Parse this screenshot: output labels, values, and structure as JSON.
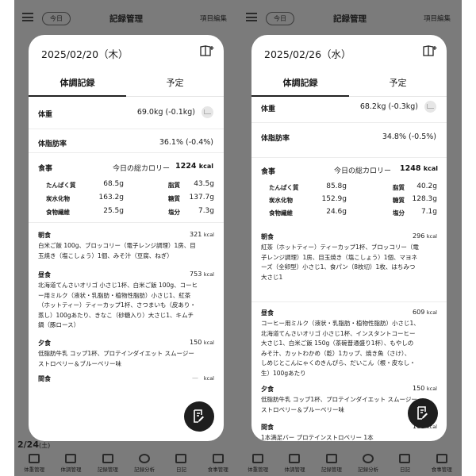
{
  "app": {
    "title": "記録管理",
    "today_label": "今日",
    "item_edit_label": "項目編集"
  },
  "nav": [
    {
      "label": "体重管理",
      "icon": "scale-icon"
    },
    {
      "label": "体調管理",
      "icon": "heart-icon"
    },
    {
      "label": "記録管理",
      "icon": "document-icon"
    },
    {
      "label": "記録分析",
      "icon": "pie-chart-icon"
    },
    {
      "label": "日記",
      "icon": "book-icon"
    },
    {
      "label": "食事管理",
      "icon": "utensils-icon"
    }
  ],
  "tabs": [
    "体調記録",
    "予定"
  ],
  "left": {
    "bg_date": "2/24",
    "bg_date_suffix": "(土)",
    "date": "2025/02/20（木）",
    "weight": {
      "label": "体重",
      "value": "69.0kg (-0.1kg)"
    },
    "fat": {
      "label": "体脂肪率",
      "value": "36.1% (-0.4%)"
    },
    "meal": {
      "label": "食事",
      "total_label": "今日の総カロリー",
      "total_value": "1224",
      "total_unit": "kcal",
      "nutrients": [
        {
          "name": "たんぱく質",
          "value": "68.5g"
        },
        {
          "name": "脂質",
          "value": "43.5g"
        },
        {
          "name": "炭水化物",
          "value": "163.2g"
        },
        {
          "name": "糖質",
          "value": "137.7g"
        },
        {
          "name": "食物繊維",
          "value": "25.5g"
        },
        {
          "name": "塩分",
          "value": "7.3g"
        }
      ]
    },
    "meals": [
      {
        "name": "朝食",
        "kcal": "321",
        "unit": "kcal",
        "desc": [
          "白米ご飯 100g、ブロッコリー（電子レンジ調理）1房、目",
          "玉焼き（塩こしょう）1個、みそ汁（豆腐、ねぎ）"
        ]
      },
      {
        "name": "昼食",
        "kcal": "753",
        "unit": "kcal",
        "desc": [
          "北海道てんさいオリゴ 小さじ1杯、白米ご飯 100g、コーヒ",
          "ー用ミルク（液状・乳脂肪・植物性脂肪）小さじ1、紅茶",
          "（ホットティー）ティーカップ1杯、さつまいも（皮あり・",
          "蒸し）100gあたり、きなこ（砂糖入り）大さじ1、キムチ",
          "鍋（豚ロース）"
        ]
      },
      {
        "name": "夕食",
        "kcal": "150",
        "unit": "kcal",
        "desc": [
          "低脂肪牛乳 コップ1杯、プロテインダイエット スムージー",
          "ストロベリー＆ブルーベリー味"
        ]
      },
      {
        "name": "間食",
        "kcal": "",
        "dash": "—",
        "unit": "kcal",
        "desc": []
      }
    ]
  },
  "right": {
    "date": "2025/02/26（水）",
    "weight": {
      "label": "体重",
      "value": "68.2kg (-0.3kg)"
    },
    "fat": {
      "label": "体脂肪率",
      "value": "34.8% (-0.5%)"
    },
    "meal": {
      "label": "食事",
      "total_label": "今日の総カロリー",
      "total_value": "1248",
      "total_unit": "kcal",
      "nutrients": [
        {
          "name": "たんぱく質",
          "value": "85.8g"
        },
        {
          "name": "脂質",
          "value": "40.2g"
        },
        {
          "name": "炭水化物",
          "value": "152.9g"
        },
        {
          "name": "糖質",
          "value": "128.3g"
        },
        {
          "name": "食物繊維",
          "value": "24.6g"
        },
        {
          "name": "塩分",
          "value": "7.1g"
        }
      ]
    },
    "meals": [
      {
        "name": "朝食",
        "kcal": "296",
        "unit": "kcal",
        "desc": [
          "紅茶（ホットティー）ティーカップ1杯、ブロッコリー（電",
          "子レンジ調理）1房、目玉焼き（塩こしょう）1個、マヨネ",
          "ーズ（全卵型）小さじ1、食パン（8枚切）1枚、はちみつ",
          "大さじ1"
        ]
      },
      {
        "name": "昼食",
        "kcal": "609",
        "unit": "kcal",
        "desc": [
          "コーヒー用ミルク（液状・乳脂肪・植物性脂肪）小さじ1、",
          "北海道てんさいオリゴ 小さじ1杯、インスタントコーヒー",
          "大さじ1、白米ご飯 150g（茶碗普通盛り1杯）、もやしの",
          "みそ汁、カットわかめ（乾）1カップ、焼き魚（さけ）、",
          "しめじとこんにゃくのきんぴら、だいこん（根・皮なし・",
          "生）100gあたり"
        ]
      },
      {
        "name": "夕食",
        "kcal": "150",
        "unit": "kcal",
        "desc": [
          "低脂肪牛乳 コップ1杯、プロテインダイエット スムージー",
          "ストロベリー＆ブルーベリー味"
        ]
      },
      {
        "name": "間食",
        "kcal": "100",
        "unit": "kcal",
        "desc": [
          "1本満足バー プロテインストロベリー 1本"
        ]
      }
    ]
  }
}
